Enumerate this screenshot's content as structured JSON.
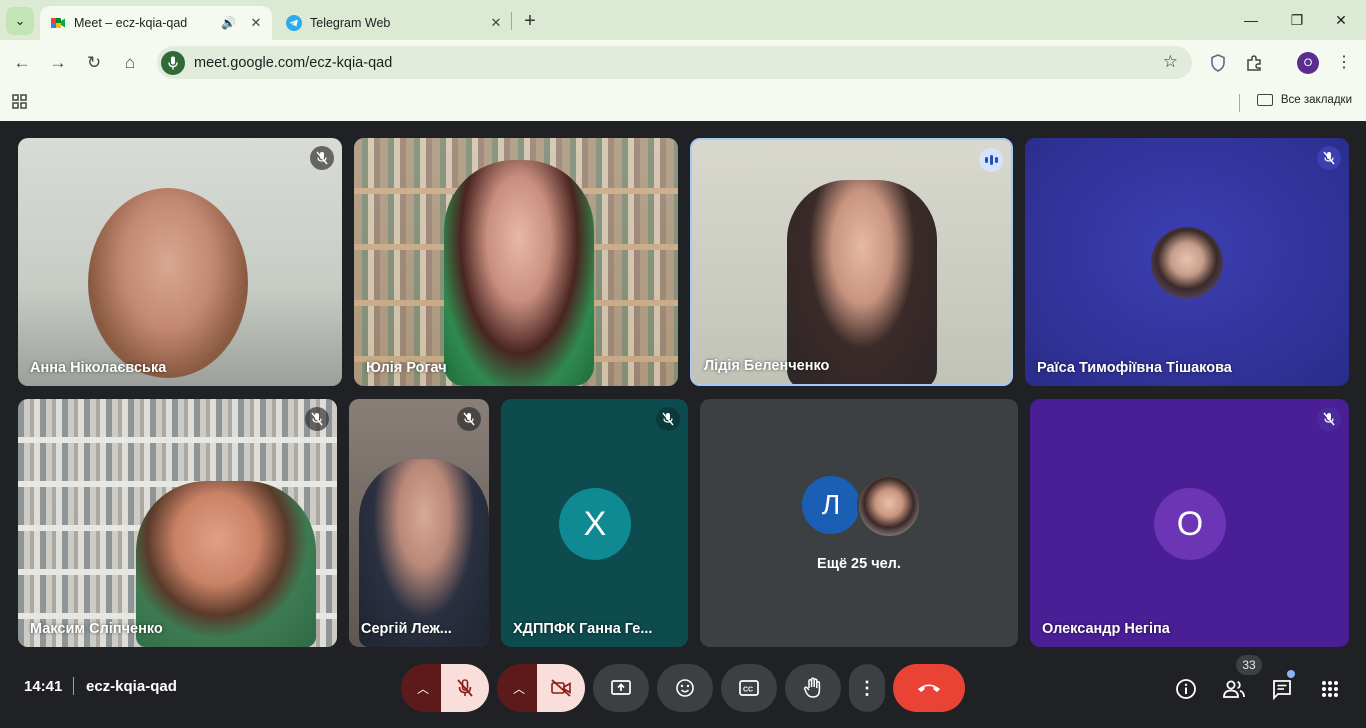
{
  "browser": {
    "tabs": [
      {
        "title": "Meet – ecz-kqia-qad",
        "active": true
      },
      {
        "title": "Telegram Web",
        "active": false
      }
    ],
    "url": "meet.google.com/ecz-kqia-qad",
    "profile_initial": "O",
    "bookmarks_all_label": "Все закладки"
  },
  "tiles": [
    {
      "name": "Анна Ніколаєвська",
      "muted": true
    },
    {
      "name": "Юлія Рогач",
      "muted": false
    },
    {
      "name": "Лідія Беленченко",
      "muted": false,
      "speaking": true
    },
    {
      "name": "Раїса Тимофіївна Тішакова",
      "muted": true
    },
    {
      "name": "Максим Сліпченко",
      "muted": true
    },
    {
      "name": "Сергій Леж...",
      "muted": true
    },
    {
      "name": "ХДППФК Ганна Ге...",
      "muted": true,
      "avatar_letter": "Х"
    },
    {
      "name": "",
      "overflow_avatar_letter": "Л",
      "overflow_label": "Ещё 25 чел."
    },
    {
      "name": "Олександр Негіпа",
      "muted": true,
      "avatar_letter": "О"
    }
  ],
  "bottom_bar": {
    "time": "14:41",
    "meeting_code": "ecz-kqia-qad",
    "participants_count": "33"
  },
  "colors": {
    "end_call": "#ea4335",
    "muted_red": "#f9dedc",
    "speaking_blue": "#1a52c6"
  }
}
